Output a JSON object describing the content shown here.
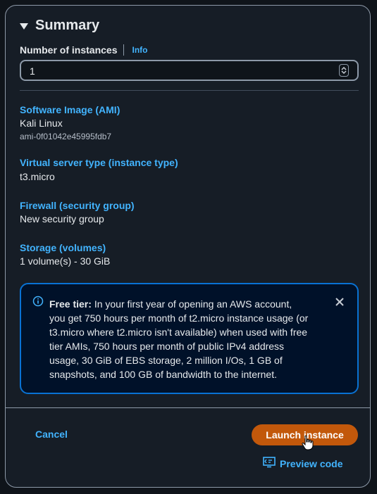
{
  "summary": {
    "title": "Summary",
    "instances_label": "Number of instances",
    "info_link": "Info",
    "instances_value": "1"
  },
  "fields": [
    {
      "title": "Software Image (AMI)",
      "value": "Kali Linux",
      "sub": "ami-0f01042e45995fdb7"
    },
    {
      "title": "Virtual server type (instance type)",
      "value": "t3.micro"
    },
    {
      "title": "Firewall (security group)",
      "value": "New security group"
    },
    {
      "title": "Storage (volumes)",
      "value": "1 volume(s) - 30 GiB"
    }
  ],
  "alert": {
    "heading": "Free tier:",
    "body": "In your first year of opening an AWS account, you get 750 hours per month of t2.micro instance usage (or t3.micro where t2.micro isn't available) when used with free tier AMIs, 750 hours per month of public IPv4 address usage, 30 GiB of EBS storage, 2 million I/Os, 1 GB of snapshots, and 100 GB of bandwidth to the internet."
  },
  "actions": {
    "cancel": "Cancel",
    "launch": "Launch instance",
    "preview": "Preview code"
  },
  "colors": {
    "accent_link": "#42b4ff",
    "primary_button": "#c2580b",
    "alert_border": "#0972d3"
  }
}
